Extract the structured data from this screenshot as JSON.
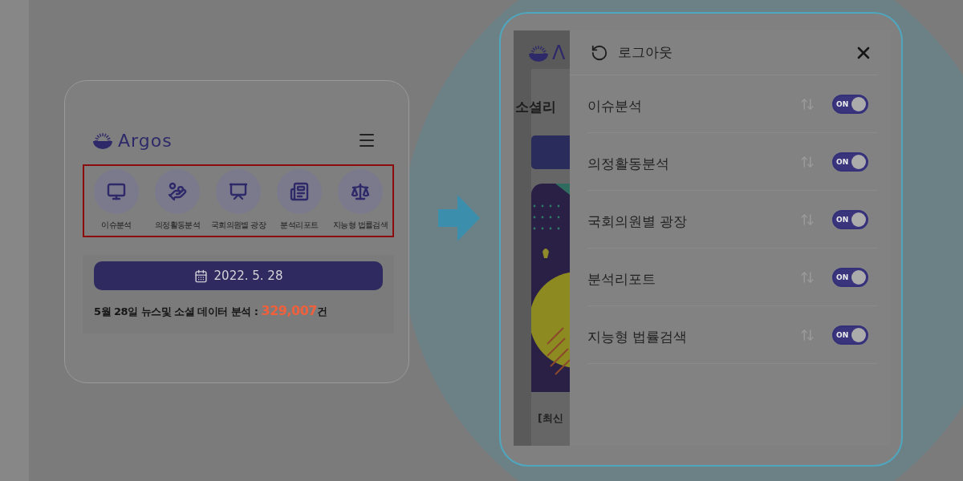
{
  "left_screen": {
    "logo": {
      "name": "Argos"
    },
    "menu": [
      {
        "kind": "monitor",
        "label": "이슈분석"
      },
      {
        "kind": "hand",
        "label": "의정활동분석"
      },
      {
        "kind": "board",
        "label": "국회의원별 광장"
      },
      {
        "kind": "report",
        "label": "분석리포트"
      },
      {
        "kind": "scale",
        "label": "지능형 법률검색"
      }
    ],
    "date_button": "2022. 5. 28",
    "stats": {
      "prefix": "5월 28일 뉴스및 소셜 데이터 분석 :",
      "count": "329,007",
      "suffix": "건"
    }
  },
  "right_screen": {
    "background_page": {
      "logo": "Λ",
      "heading": "소셜리",
      "article": "[최신"
    },
    "drawer": {
      "logout": "로그아웃",
      "items": [
        {
          "label": "이슈분석",
          "toggle": "ON",
          "on": true
        },
        {
          "label": "의정활동분석",
          "toggle": "ON",
          "on": true
        },
        {
          "label": "국회의원별 광장",
          "toggle": "ON",
          "on": true
        },
        {
          "label": "분석리포트",
          "toggle": "ON",
          "on": true
        },
        {
          "label": "지능형 법률검색",
          "toggle": "ON",
          "on": true
        }
      ]
    }
  }
}
